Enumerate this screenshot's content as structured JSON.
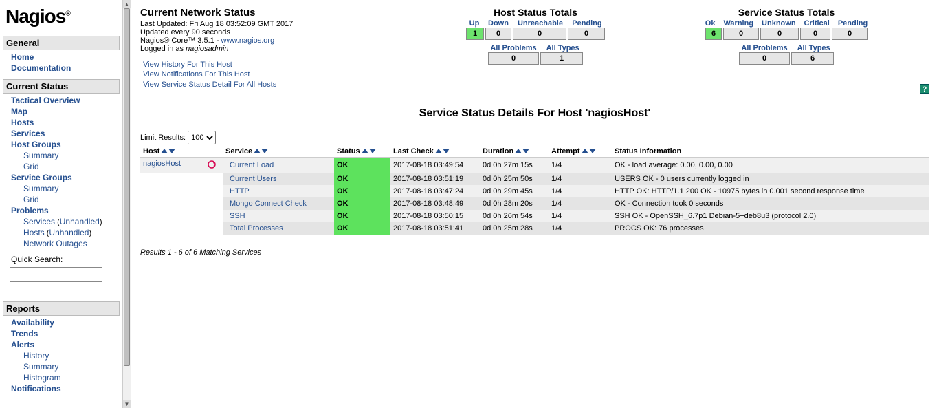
{
  "logo": "Nagios",
  "nav": {
    "general": {
      "header": "General",
      "items": [
        "Home",
        "Documentation"
      ]
    },
    "current_status": {
      "header": "Current Status",
      "items": [
        {
          "label": "Tactical Overview"
        },
        {
          "label": "Map"
        },
        {
          "label": "Hosts"
        },
        {
          "label": "Services"
        },
        {
          "label": "Host Groups"
        },
        {
          "label": "Summary",
          "sub": true
        },
        {
          "label": "Grid",
          "sub": true
        },
        {
          "label": "Service Groups"
        },
        {
          "label": "Summary",
          "sub": true
        },
        {
          "label": "Grid",
          "sub": true
        },
        {
          "label": "Problems"
        },
        {
          "label": "Services",
          "sub": true,
          "unhandled": "Unhandled"
        },
        {
          "label": "Hosts",
          "sub": true,
          "unhandled": "Unhandled"
        },
        {
          "label": "Network Outages",
          "sub": true
        }
      ],
      "quick_search": "Quick Search:"
    },
    "reports": {
      "header": "Reports",
      "items": [
        {
          "label": "Availability"
        },
        {
          "label": "Trends"
        },
        {
          "label": "Alerts"
        },
        {
          "label": "History",
          "sub": true
        },
        {
          "label": "Summary",
          "sub": true
        },
        {
          "label": "Histogram",
          "sub": true
        },
        {
          "label": "Notifications"
        }
      ]
    }
  },
  "status": {
    "title": "Current Network Status",
    "last_updated": "Last Updated: Fri Aug 18 03:52:09 GMT 2017",
    "updated_every": "Updated every 90 seconds",
    "core_text": "Nagios® Core™ 3.5.1 - ",
    "core_link": "www.nagios.org",
    "logged_in": "Logged in as ",
    "user": "nagiosadmin",
    "view_history": "View History For This Host",
    "view_notifications": "View Notifications For This Host",
    "view_all": "View Service Status Detail For All Hosts"
  },
  "host_totals": {
    "title": "Host Status Totals",
    "headers": [
      "Up",
      "Down",
      "Unreachable",
      "Pending"
    ],
    "values": [
      "1",
      "0",
      "0",
      "0"
    ],
    "sub_headers": [
      "All Problems",
      "All Types"
    ],
    "sub_values": [
      "0",
      "1"
    ]
  },
  "service_totals": {
    "title": "Service Status Totals",
    "headers": [
      "Ok",
      "Warning",
      "Unknown",
      "Critical",
      "Pending"
    ],
    "values": [
      "6",
      "0",
      "0",
      "0",
      "0"
    ],
    "sub_headers": [
      "All Problems",
      "All Types"
    ],
    "sub_values": [
      "0",
      "6"
    ]
  },
  "page_title": "Service Status Details For Host 'nagiosHost'",
  "limit": {
    "label": "Limit Results:",
    "value": "100"
  },
  "table": {
    "headers": [
      "Host",
      "Service",
      "Status",
      "Last Check",
      "Duration",
      "Attempt",
      "Status Information"
    ],
    "host": "nagiosHost",
    "rows": [
      {
        "service": "Current Load",
        "status": "OK",
        "last_check": "2017-08-18 03:49:54",
        "duration": "0d 0h 27m 15s",
        "attempt": "1/4",
        "info": "OK - load average: 0.00, 0.00, 0.00"
      },
      {
        "service": "Current Users",
        "status": "OK",
        "last_check": "2017-08-18 03:51:19",
        "duration": "0d 0h 25m 50s",
        "attempt": "1/4",
        "info": "USERS OK - 0 users currently logged in"
      },
      {
        "service": "HTTP",
        "status": "OK",
        "last_check": "2017-08-18 03:47:24",
        "duration": "0d 0h 29m 45s",
        "attempt": "1/4",
        "info": "HTTP OK: HTTP/1.1 200 OK - 10975 bytes in 0.001 second response time"
      },
      {
        "service": "Mongo Connect Check",
        "status": "OK",
        "last_check": "2017-08-18 03:48:49",
        "duration": "0d 0h 28m 20s",
        "attempt": "1/4",
        "info": "OK - Connection took 0 seconds"
      },
      {
        "service": "SSH",
        "status": "OK",
        "last_check": "2017-08-18 03:50:15",
        "duration": "0d 0h 26m 54s",
        "attempt": "1/4",
        "info": "SSH OK - OpenSSH_6.7p1 Debian-5+deb8u3 (protocol 2.0)"
      },
      {
        "service": "Total Processes",
        "status": "OK",
        "last_check": "2017-08-18 03:51:41",
        "duration": "0d 0h 25m 28s",
        "attempt": "1/4",
        "info": "PROCS OK: 76 processes"
      }
    ]
  },
  "results_line": "Results 1 - 6 of 6 Matching Services",
  "help": "?"
}
